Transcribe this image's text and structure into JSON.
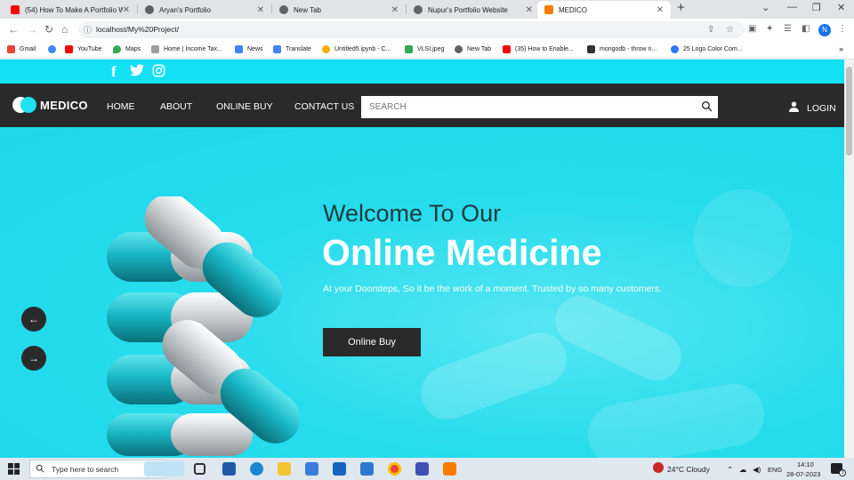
{
  "browser": {
    "tabs": [
      {
        "label": "(54) How To Make A Portfolio We",
        "favicon_color": "#ff0000"
      },
      {
        "label": "Aryan's Portfolio",
        "favicon_color": "#5f6368"
      },
      {
        "label": "New Tab",
        "favicon_color": "#5f6368"
      },
      {
        "label": "Nupur's Portfolio Website",
        "favicon_color": "#5f6368"
      },
      {
        "label": "MEDICO",
        "favicon_color": "#f57c00"
      }
    ],
    "new_tab_label": "+",
    "url": "localhost/My%20Project/",
    "profile_initial": "N",
    "bookmarks": [
      {
        "label": "Gmail",
        "color": "#ea4335"
      },
      {
        "label": "",
        "color": "#4285f4"
      },
      {
        "label": "YouTube",
        "color": "#ff0000"
      },
      {
        "label": "Maps",
        "color": "#34a853"
      },
      {
        "label": "Home | Income Tax...",
        "color": "#9e9e9e"
      },
      {
        "label": "News",
        "color": "#4285f4"
      },
      {
        "label": "Translate",
        "color": "#4285f4"
      },
      {
        "label": "Untitled5.ipynb - C...",
        "color": "#f9ab00"
      },
      {
        "label": "VLSI.jpeg",
        "color": "#34a853"
      },
      {
        "label": "New Tab",
        "color": "#5f6368"
      },
      {
        "label": "(35) How to Enable...",
        "color": "#ff0000"
      },
      {
        "label": "mongodb - throw n...",
        "color": "#333333"
      },
      {
        "label": "25 Logo Color Com...",
        "color": "#2979ff"
      }
    ],
    "more_bookmarks": "»"
  },
  "site": {
    "brand": "MEDICO",
    "accent": "#1de0f0",
    "dark": "#2a2a2a",
    "social": [
      "f",
      "twitter",
      "instagram"
    ],
    "nav": [
      "HOME",
      "ABOUT",
      "ONLINE BUY",
      "CONTACT US"
    ],
    "search_placeholder": "SEARCH",
    "login": "LOGIN",
    "hero": {
      "welcome": "Welcome To Our",
      "headline": "Online Medicine",
      "subtext": "At your Doorsteps, So it be the work of a moment. Trusted by so many customers.",
      "cta": "Online Buy"
    },
    "slider_prev": "←",
    "slider_next": "→"
  },
  "taskbar": {
    "search_placeholder": "Type here to search",
    "weather": "24°C  Cloudy",
    "language": "ENG",
    "time": "14:10",
    "date": "28-07-2023",
    "notification_count": "3"
  }
}
